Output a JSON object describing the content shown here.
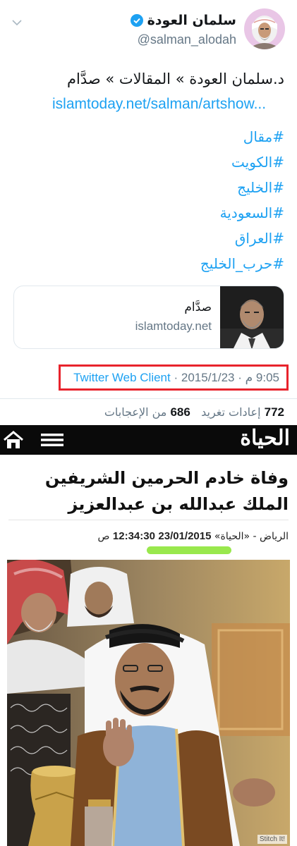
{
  "tweet": {
    "display_name": "سلمان العودة",
    "handle": "@salman_alodah",
    "verified": true,
    "title_text": "د.سلمان العودة » المقالات » صدَّام",
    "link_text": "islamtoday.net/salman/artshow...",
    "hashtags": [
      "#مقال",
      "#الكويت",
      "#الخليج",
      "#السعودية",
      "#العراق",
      "#حرب_الخليج"
    ],
    "card": {
      "title": "صدَّام",
      "domain": "islamtoday.net"
    },
    "meta": {
      "time": "9:05 م",
      "separator": "·",
      "date": "2015/1/23",
      "client": "Twitter Web Client"
    },
    "stats": {
      "retweets_count": "772",
      "retweets_label": "إعادات تغريد",
      "likes_count": "686",
      "likes_label": "من الإعجابات"
    },
    "colors": {
      "link_blue": "#1da1f2",
      "muted_gray": "#657786",
      "highlight_box_red": "#e8232c"
    }
  },
  "article": {
    "site_name": "الحياة",
    "headline": "وفاة خادم الحرمين الشريفين الملك عبدالله بن عبدالعزيز",
    "dateline_prefix": "الرياض - «الحياة»",
    "date": "23/01/2015",
    "time": "12:34:30",
    "ampm": "ص",
    "icons": [
      "home-icon",
      "menu-icon"
    ],
    "colors": {
      "bar_black": "#0a0a0a",
      "marker_green": "#8ee63a"
    }
  },
  "watermark": "Stitch It!"
}
